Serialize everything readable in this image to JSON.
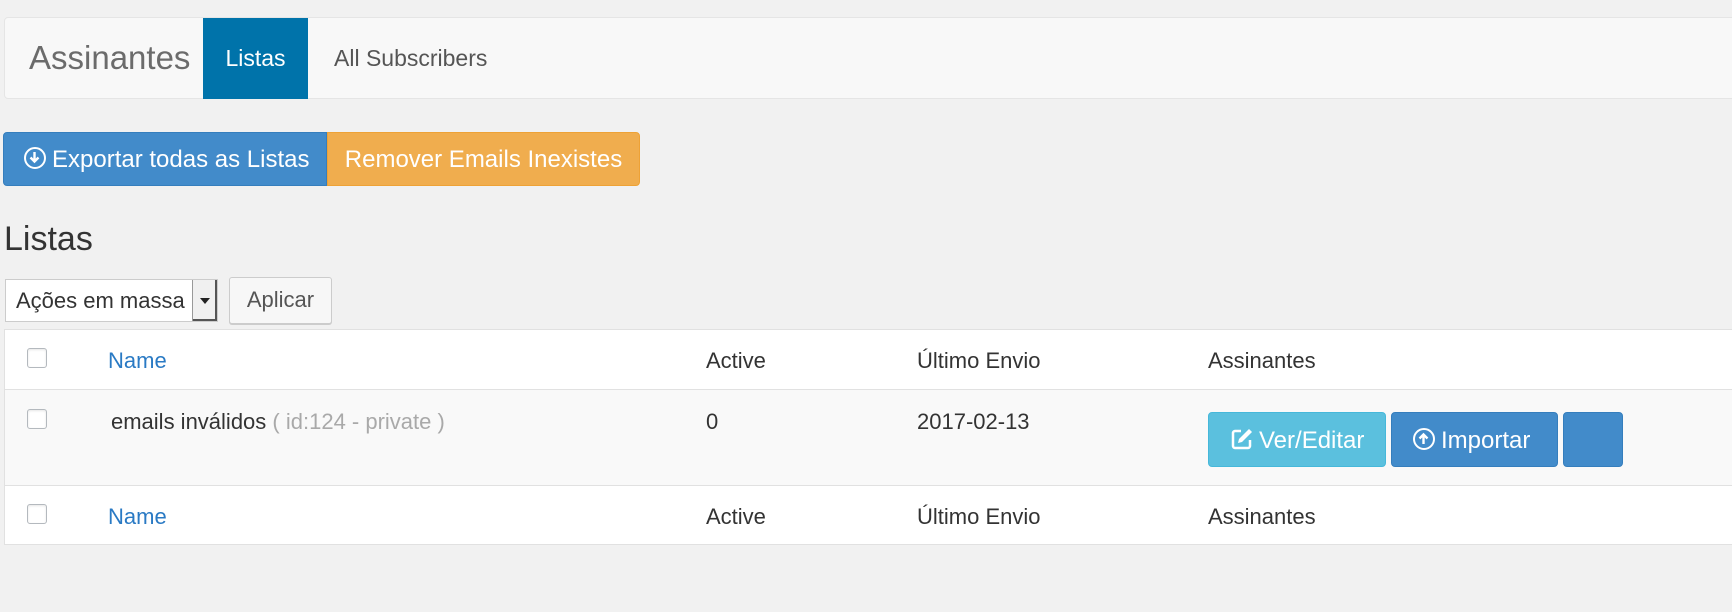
{
  "header": {
    "brand": "Assinantes",
    "tabs": [
      {
        "label": "Listas",
        "active": true
      },
      {
        "label": "All Subscribers",
        "active": false
      }
    ]
  },
  "actions": {
    "export_all": "Exportar todas as Listas",
    "remove_invalid": "Remover Emails Inexistes"
  },
  "section_title": "Listas",
  "bulk": {
    "selected": "Ações em massa",
    "apply": "Aplicar"
  },
  "table": {
    "columns": [
      "Name",
      "Active",
      "Último Envio",
      "Assinantes"
    ],
    "rows": [
      {
        "name": "emails inválidos",
        "meta": "( id:124 - private )",
        "active": "0",
        "last_send": "2017-02-13",
        "actions": {
          "view_edit": "Ver/Editar",
          "import": "Importar"
        }
      }
    ]
  },
  "colors": {
    "tab_active": "#0073aa",
    "btn_primary": "#428bca",
    "btn_warning": "#f0ad4e",
    "btn_info": "#5bc0de",
    "link": "#2a7ac4"
  },
  "icons": {
    "export": "arrow-down-circle-icon",
    "view_edit": "edit-icon",
    "import": "arrow-up-circle-icon"
  }
}
